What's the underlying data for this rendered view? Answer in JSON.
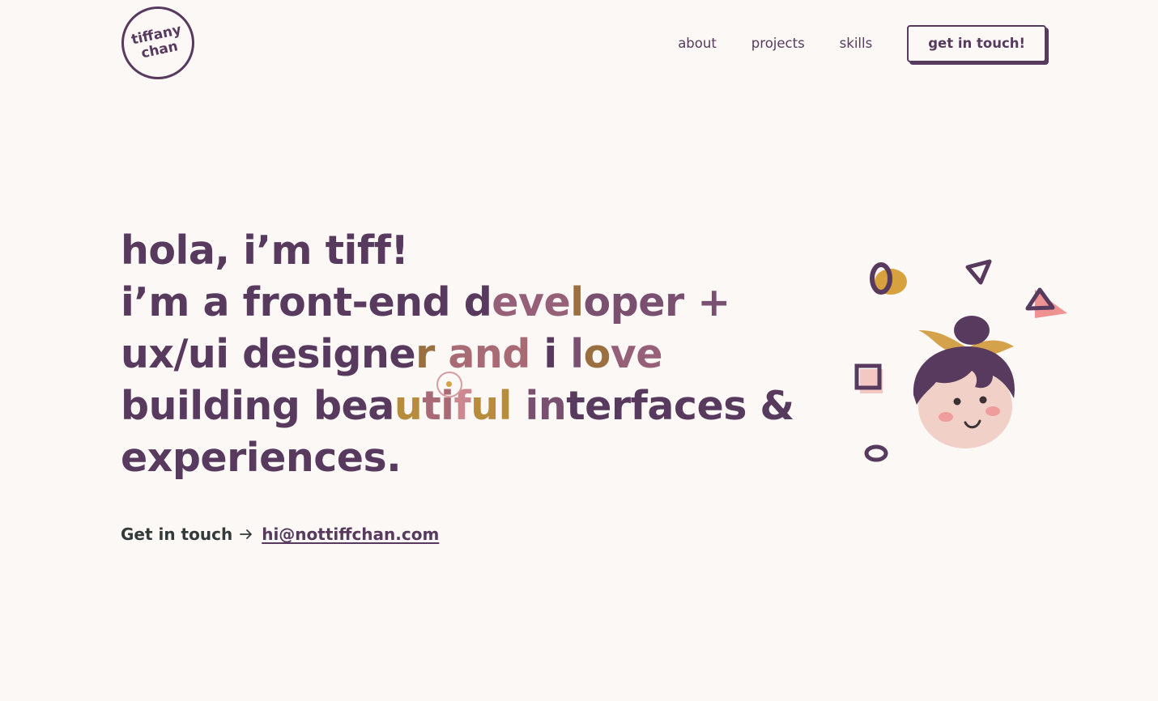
{
  "header": {
    "logo": {
      "line1": "tiffany",
      "line2": "chan"
    },
    "nav": [
      {
        "label": "about"
      },
      {
        "label": "projects"
      },
      {
        "label": "skills"
      }
    ],
    "cta_label": "get in touch!"
  },
  "hero": {
    "line1": "hola, i’m tiff!",
    "line2": {
      "a": "i’m a front-end d",
      "b": "eve",
      "c": "l",
      "d": "oper +"
    },
    "line3": {
      "a": "ux/ui designe",
      "b": "r",
      "c": "and",
      "d": "i ",
      "e": "l",
      "f": "o",
      "g": "ve"
    },
    "line4": {
      "a": "building bea",
      "b": "u",
      "c": "ti",
      "d": "f",
      "e": "ul",
      "f": "in",
      "g": "terfaces &"
    },
    "line5": "experiences."
  },
  "contact": {
    "label": "Get in touch",
    "arrow_icon": "arrow-right-icon",
    "email": "hi@nottiffchan.com"
  },
  "illustration": {
    "icon": "girl-avatar-illustration",
    "colors": {
      "hair": "#573a5e",
      "ribbon": "#d4a24a",
      "skin": "#f1d0c8",
      "cheek": "#ef9c9c",
      "accent_pink": "#ee8f96"
    }
  },
  "colors": {
    "background": "#fcf8f6",
    "primary": "#573a5e",
    "text_dark": "#333a3a"
  }
}
